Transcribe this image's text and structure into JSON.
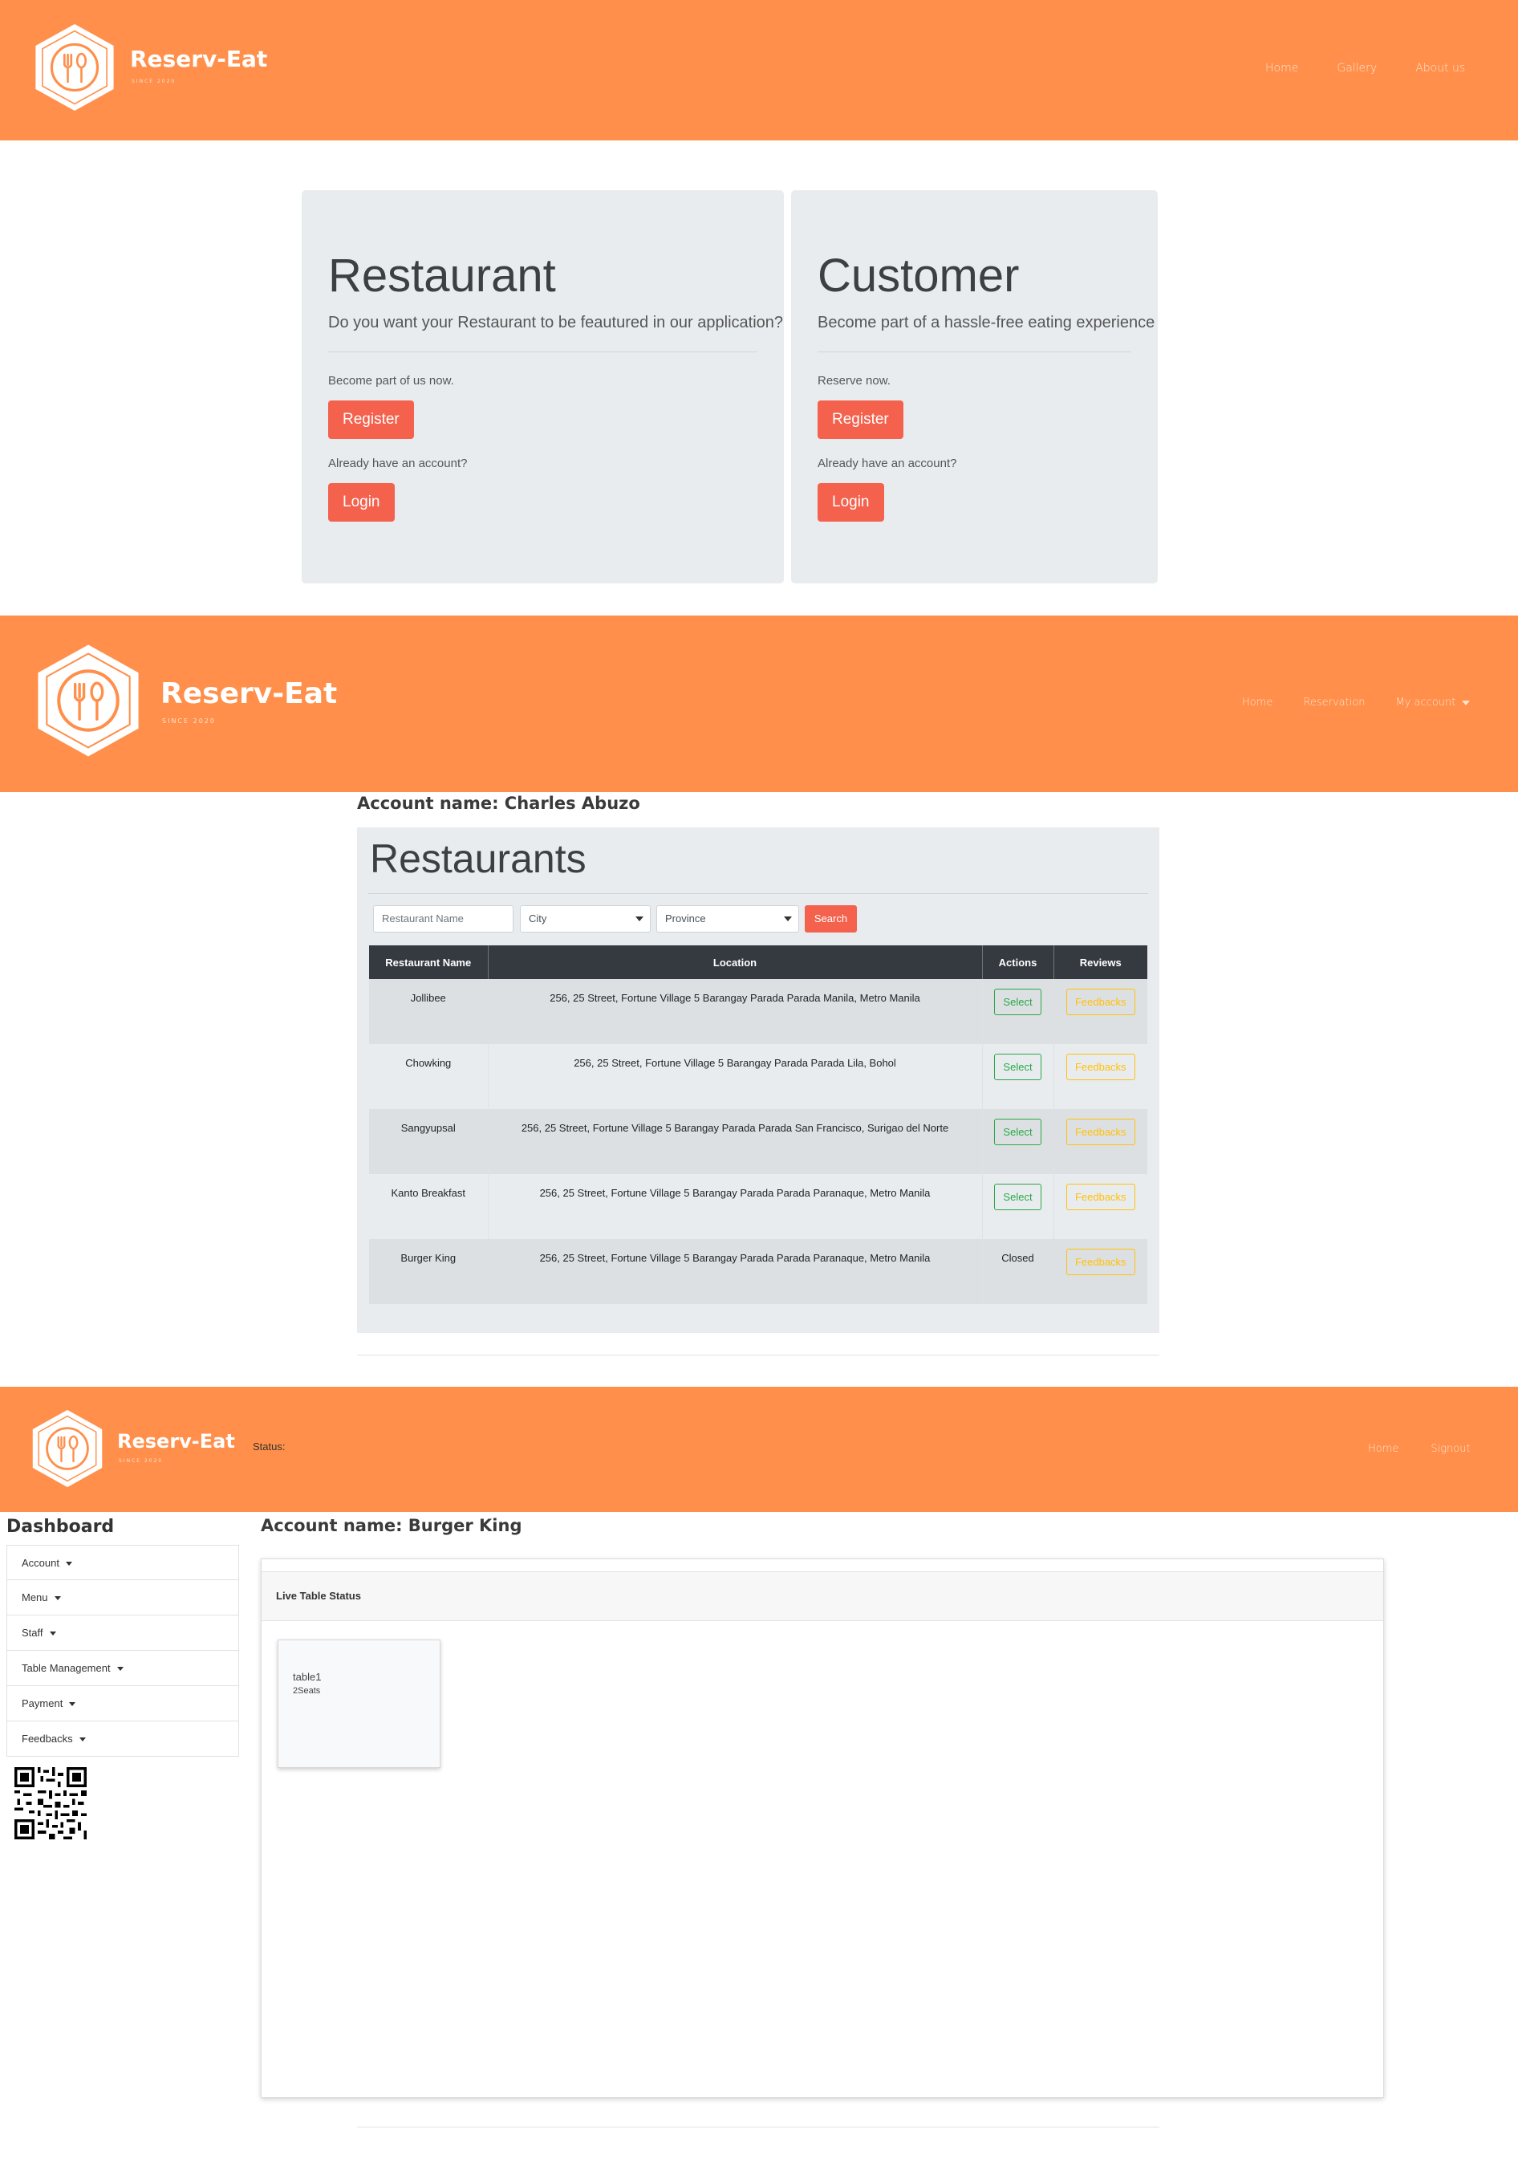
{
  "brand": {
    "name": "Reserv-Eat",
    "since": "SINCE 2020"
  },
  "section1": {
    "nav": [
      "Home",
      "Gallery",
      "About us"
    ],
    "restaurant": {
      "title": "Restaurant",
      "lead": "Do you want your Restaurant to be feautured in our application?",
      "join_text": "Become part of us now.",
      "register_label": "Register",
      "account_text": "Already have an account?",
      "login_label": "Login"
    },
    "customer": {
      "title": "Customer",
      "lead": "Become part of a hassle-free eating experience",
      "join_text": "Reserve now.",
      "register_label": "Register",
      "account_text": "Already have an account?",
      "login_label": "Login"
    }
  },
  "section2": {
    "nav": [
      "Home",
      "Reservation",
      "My account"
    ],
    "account_name": "Account name: Charles Abuzo",
    "title": "Restaurants",
    "filters": {
      "name_placeholder": "Restaurant Name",
      "city": "City",
      "province": "Province",
      "search_label": "Search"
    },
    "columns": [
      "Restaurant Name",
      "Location",
      "Actions",
      "Reviews"
    ],
    "rows": [
      {
        "name": "Jollibee",
        "location": "256, 25 Street, Fortune Village 5 Barangay Parada Parada Manila, Metro Manila",
        "action": "Select",
        "review": "Feedbacks"
      },
      {
        "name": "Chowking",
        "location": "256, 25 Street, Fortune Village 5 Barangay Parada Parada Lila, Bohol",
        "action": "Select",
        "review": "Feedbacks"
      },
      {
        "name": "Sangyupsal",
        "location": "256, 25 Street, Fortune Village 5 Barangay Parada Parada San Francisco, Surigao del Norte",
        "action": "Select",
        "review": "Feedbacks"
      },
      {
        "name": "Kanto Breakfast",
        "location": "256, 25 Street, Fortune Village 5 Barangay Parada Parada Paranaque, Metro Manila",
        "action": "Select",
        "review": "Feedbacks"
      },
      {
        "name": "Burger King",
        "location": "256, 25 Street, Fortune Village 5 Barangay Parada Parada Paranaque, Metro Manila",
        "action": "Closed",
        "review": "Feedbacks"
      }
    ]
  },
  "section3": {
    "status_label": "Status:",
    "nav": [
      "Home",
      "Signout"
    ],
    "dashboard_title": "Dashboard",
    "menu": [
      "Account",
      "Menu",
      "Staff",
      "Table Management",
      "Payment",
      "Feedbacks"
    ],
    "account_name": "Account name: Burger King",
    "card_title": "Live Table Status",
    "tables": [
      {
        "name": "table1",
        "seats": "2Seats"
      }
    ]
  },
  "colors": {
    "navbar": "#FF8F4A",
    "primary_button": "#F4614D",
    "select": "#28A745",
    "feedback": "#FFC107",
    "table_header": "#343A40"
  },
  "icons": {
    "logo": "fork-spoon-hexagon-icon",
    "qr": "qr-code-icon"
  }
}
